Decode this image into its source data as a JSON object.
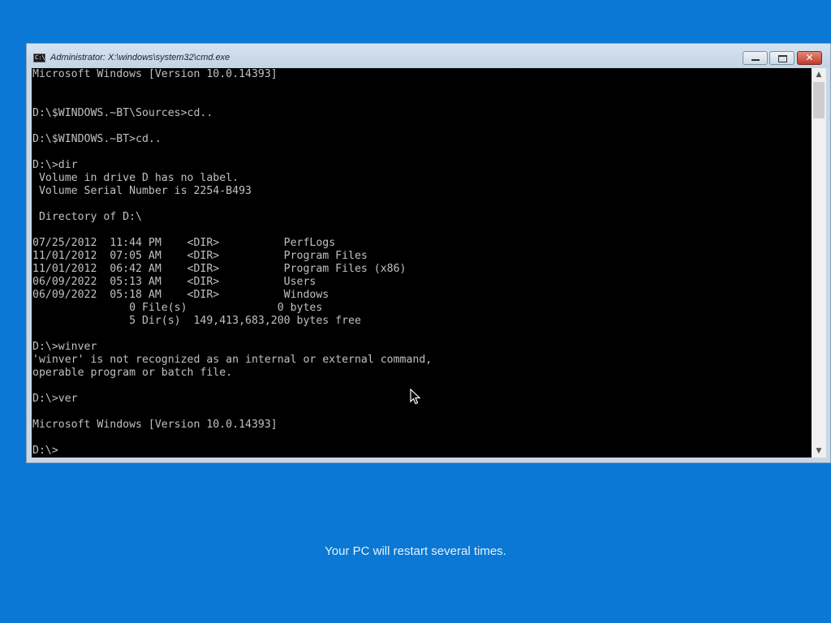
{
  "window": {
    "title": "Administrator: X:\\windows\\system32\\cmd.exe",
    "icon_label": "C:\\",
    "minimize_icon": "minimize-icon",
    "maximize_icon": "maximize-icon",
    "close_symbol": "✕"
  },
  "console": {
    "lines": [
      "Microsoft Windows [Version 10.0.14393]",
      "",
      "",
      "D:\\$WINDOWS.~BT\\Sources>cd..",
      "",
      "D:\\$WINDOWS.~BT>cd..",
      "",
      "D:\\>dir",
      " Volume in drive D has no label.",
      " Volume Serial Number is 2254-B493",
      "",
      " Directory of D:\\",
      "",
      "07/25/2012  11:44 PM    <DIR>          PerfLogs",
      "11/01/2012  07:05 AM    <DIR>          Program Files",
      "11/01/2012  06:42 AM    <DIR>          Program Files (x86)",
      "06/09/2022  05:13 AM    <DIR>          Users",
      "06/09/2022  05:18 AM    <DIR>          Windows",
      "               0 File(s)              0 bytes",
      "               5 Dir(s)  149,413,683,200 bytes free",
      "",
      "D:\\>winver",
      "'winver' is not recognized as an internal or external command,",
      "operable program or batch file.",
      "",
      "D:\\>ver",
      "",
      "Microsoft Windows [Version 10.0.14393]",
      "",
      "D:\\>"
    ]
  },
  "scrollbar": {
    "up_arrow": "▲",
    "down_arrow": "▼"
  },
  "footer": {
    "message": "Your PC will restart several times."
  }
}
